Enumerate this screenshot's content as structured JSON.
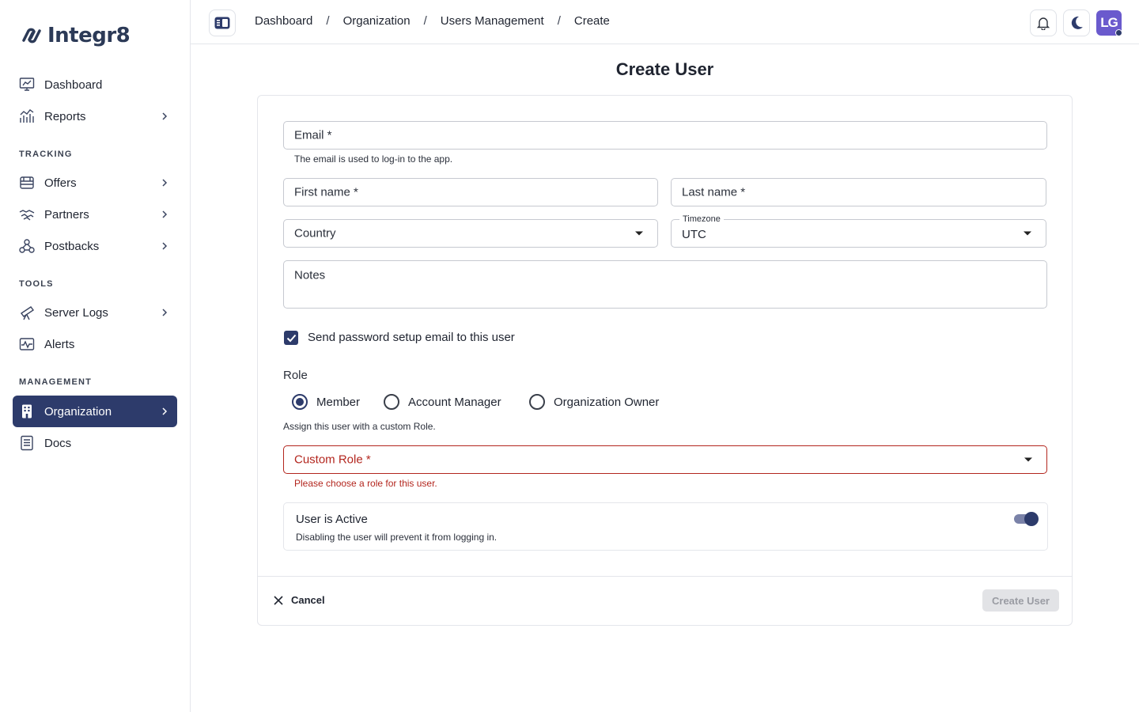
{
  "app": {
    "name": "Integr8"
  },
  "sidebar": {
    "items": [
      {
        "label": "Dashboard"
      },
      {
        "label": "Reports"
      },
      {
        "label": "Offers"
      },
      {
        "label": "Partners"
      },
      {
        "label": "Postbacks"
      },
      {
        "label": "Server Logs"
      },
      {
        "label": "Alerts"
      },
      {
        "label": "Organization"
      },
      {
        "label": "Docs"
      }
    ],
    "sections": {
      "tracking": "TRACKING",
      "tools": "TOOLS",
      "management": "MANAGEMENT"
    },
    "active_item": "Organization"
  },
  "header": {
    "breadcrumb": [
      "Dashboard",
      "Organization",
      "Users Management",
      "Create"
    ],
    "separator": "/",
    "avatar_initials": "LG"
  },
  "page": {
    "title": "Create User"
  },
  "form": {
    "email": {
      "label": "Email *",
      "helper": "The email is used to log-in to the app.",
      "value": ""
    },
    "first_name": {
      "label": "First name *",
      "value": ""
    },
    "last_name": {
      "label": "Last name *",
      "value": ""
    },
    "country": {
      "label": "Country",
      "value": ""
    },
    "timezone": {
      "label": "Timezone",
      "value": "UTC"
    },
    "notes": {
      "label": "Notes",
      "value": ""
    },
    "send_email": {
      "label": "Send password setup email to this user",
      "checked": true
    },
    "role": {
      "title": "Role",
      "options": [
        "Member",
        "Account Manager",
        "Organization Owner"
      ],
      "selected": "Member",
      "helper": "Assign this user with a custom Role."
    },
    "custom_role": {
      "label": "Custom Role *",
      "error": "Please choose a role for this user.",
      "value": ""
    },
    "active": {
      "title": "User is Active",
      "subtitle": "Disabling the user will prevent it from logging in.",
      "enabled": true
    }
  },
  "actions": {
    "cancel": "Cancel",
    "submit": "Create User"
  },
  "colors": {
    "primary": "#2d3b6b",
    "error": "#b3261e",
    "avatar": "#6a5acd"
  }
}
